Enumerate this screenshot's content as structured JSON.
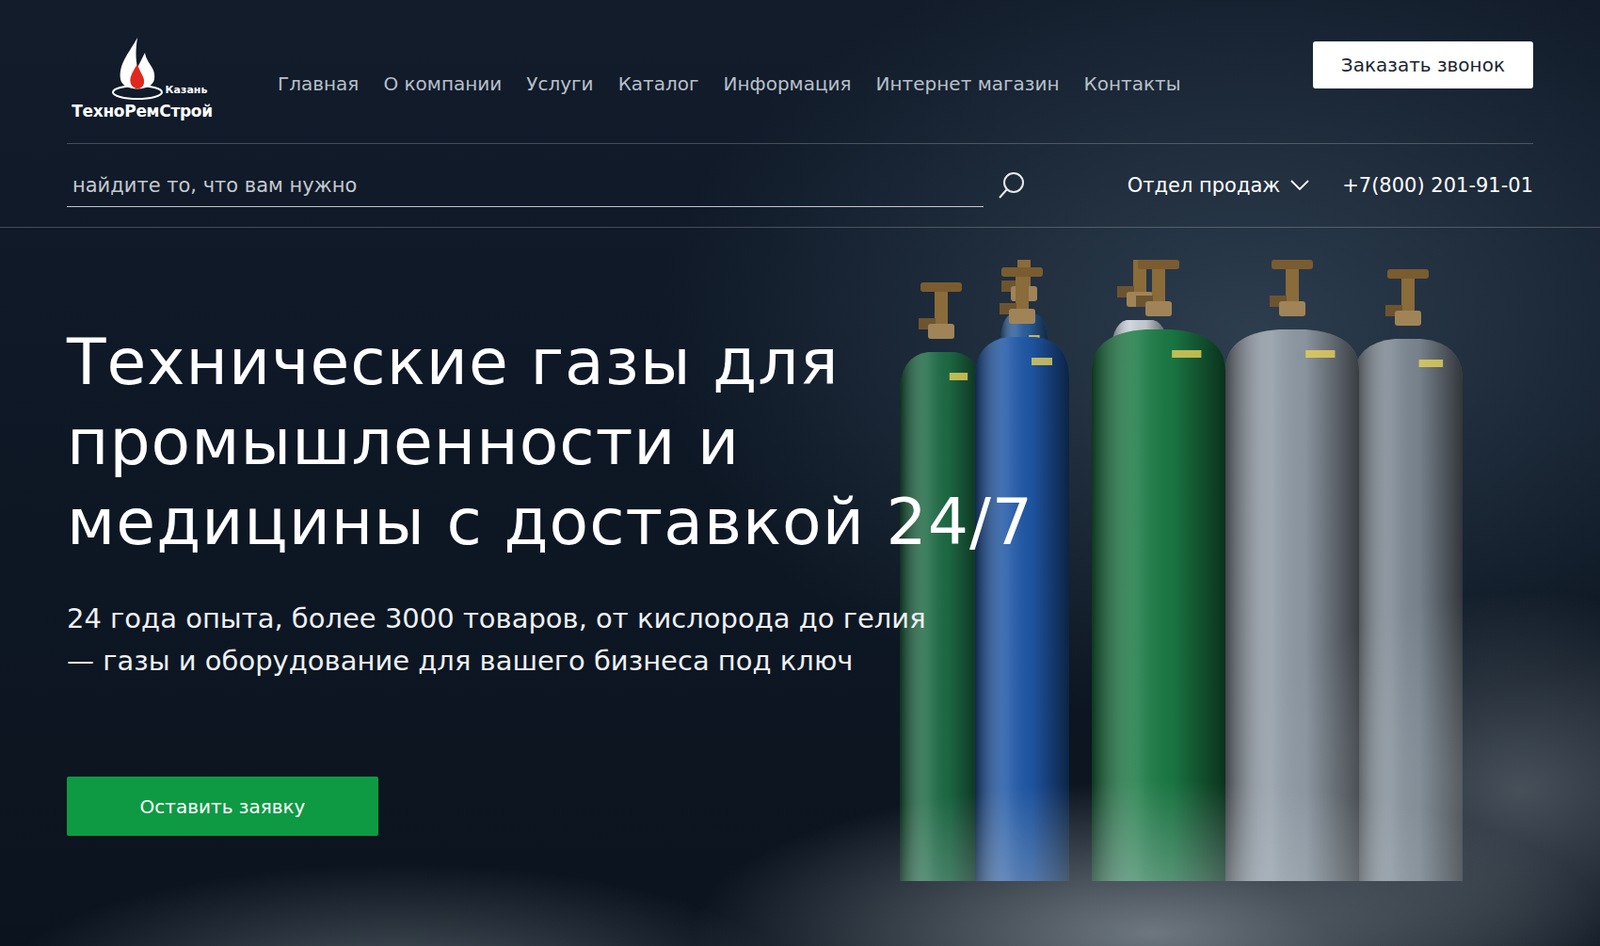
{
  "logo": {
    "city": "Казань",
    "name": "ТехноРемСтрой"
  },
  "nav": [
    {
      "label": "Главная"
    },
    {
      "label": "О компании"
    },
    {
      "label": "Услуги"
    },
    {
      "label": "Каталог"
    },
    {
      "label": "Информация"
    },
    {
      "label": "Интернет магазин"
    },
    {
      "label": "Контакты"
    }
  ],
  "callback_button": "Заказать звонок",
  "search": {
    "placeholder": "найдите то, что вам нужно"
  },
  "sales": {
    "label": "Отдел продаж",
    "phone": "+7(800) 201-91-01"
  },
  "hero": {
    "title_lines": [
      "Технические газы для",
      "промышленности и",
      "медицины с доставкой 24/7"
    ],
    "subtitle_lines": [
      "24 года опыта, более 3000 товаров, от кислорода до гелия",
      "— газы и оборудование для вашего бизнеса под ключ"
    ],
    "button": "Оставить заявку"
  }
}
